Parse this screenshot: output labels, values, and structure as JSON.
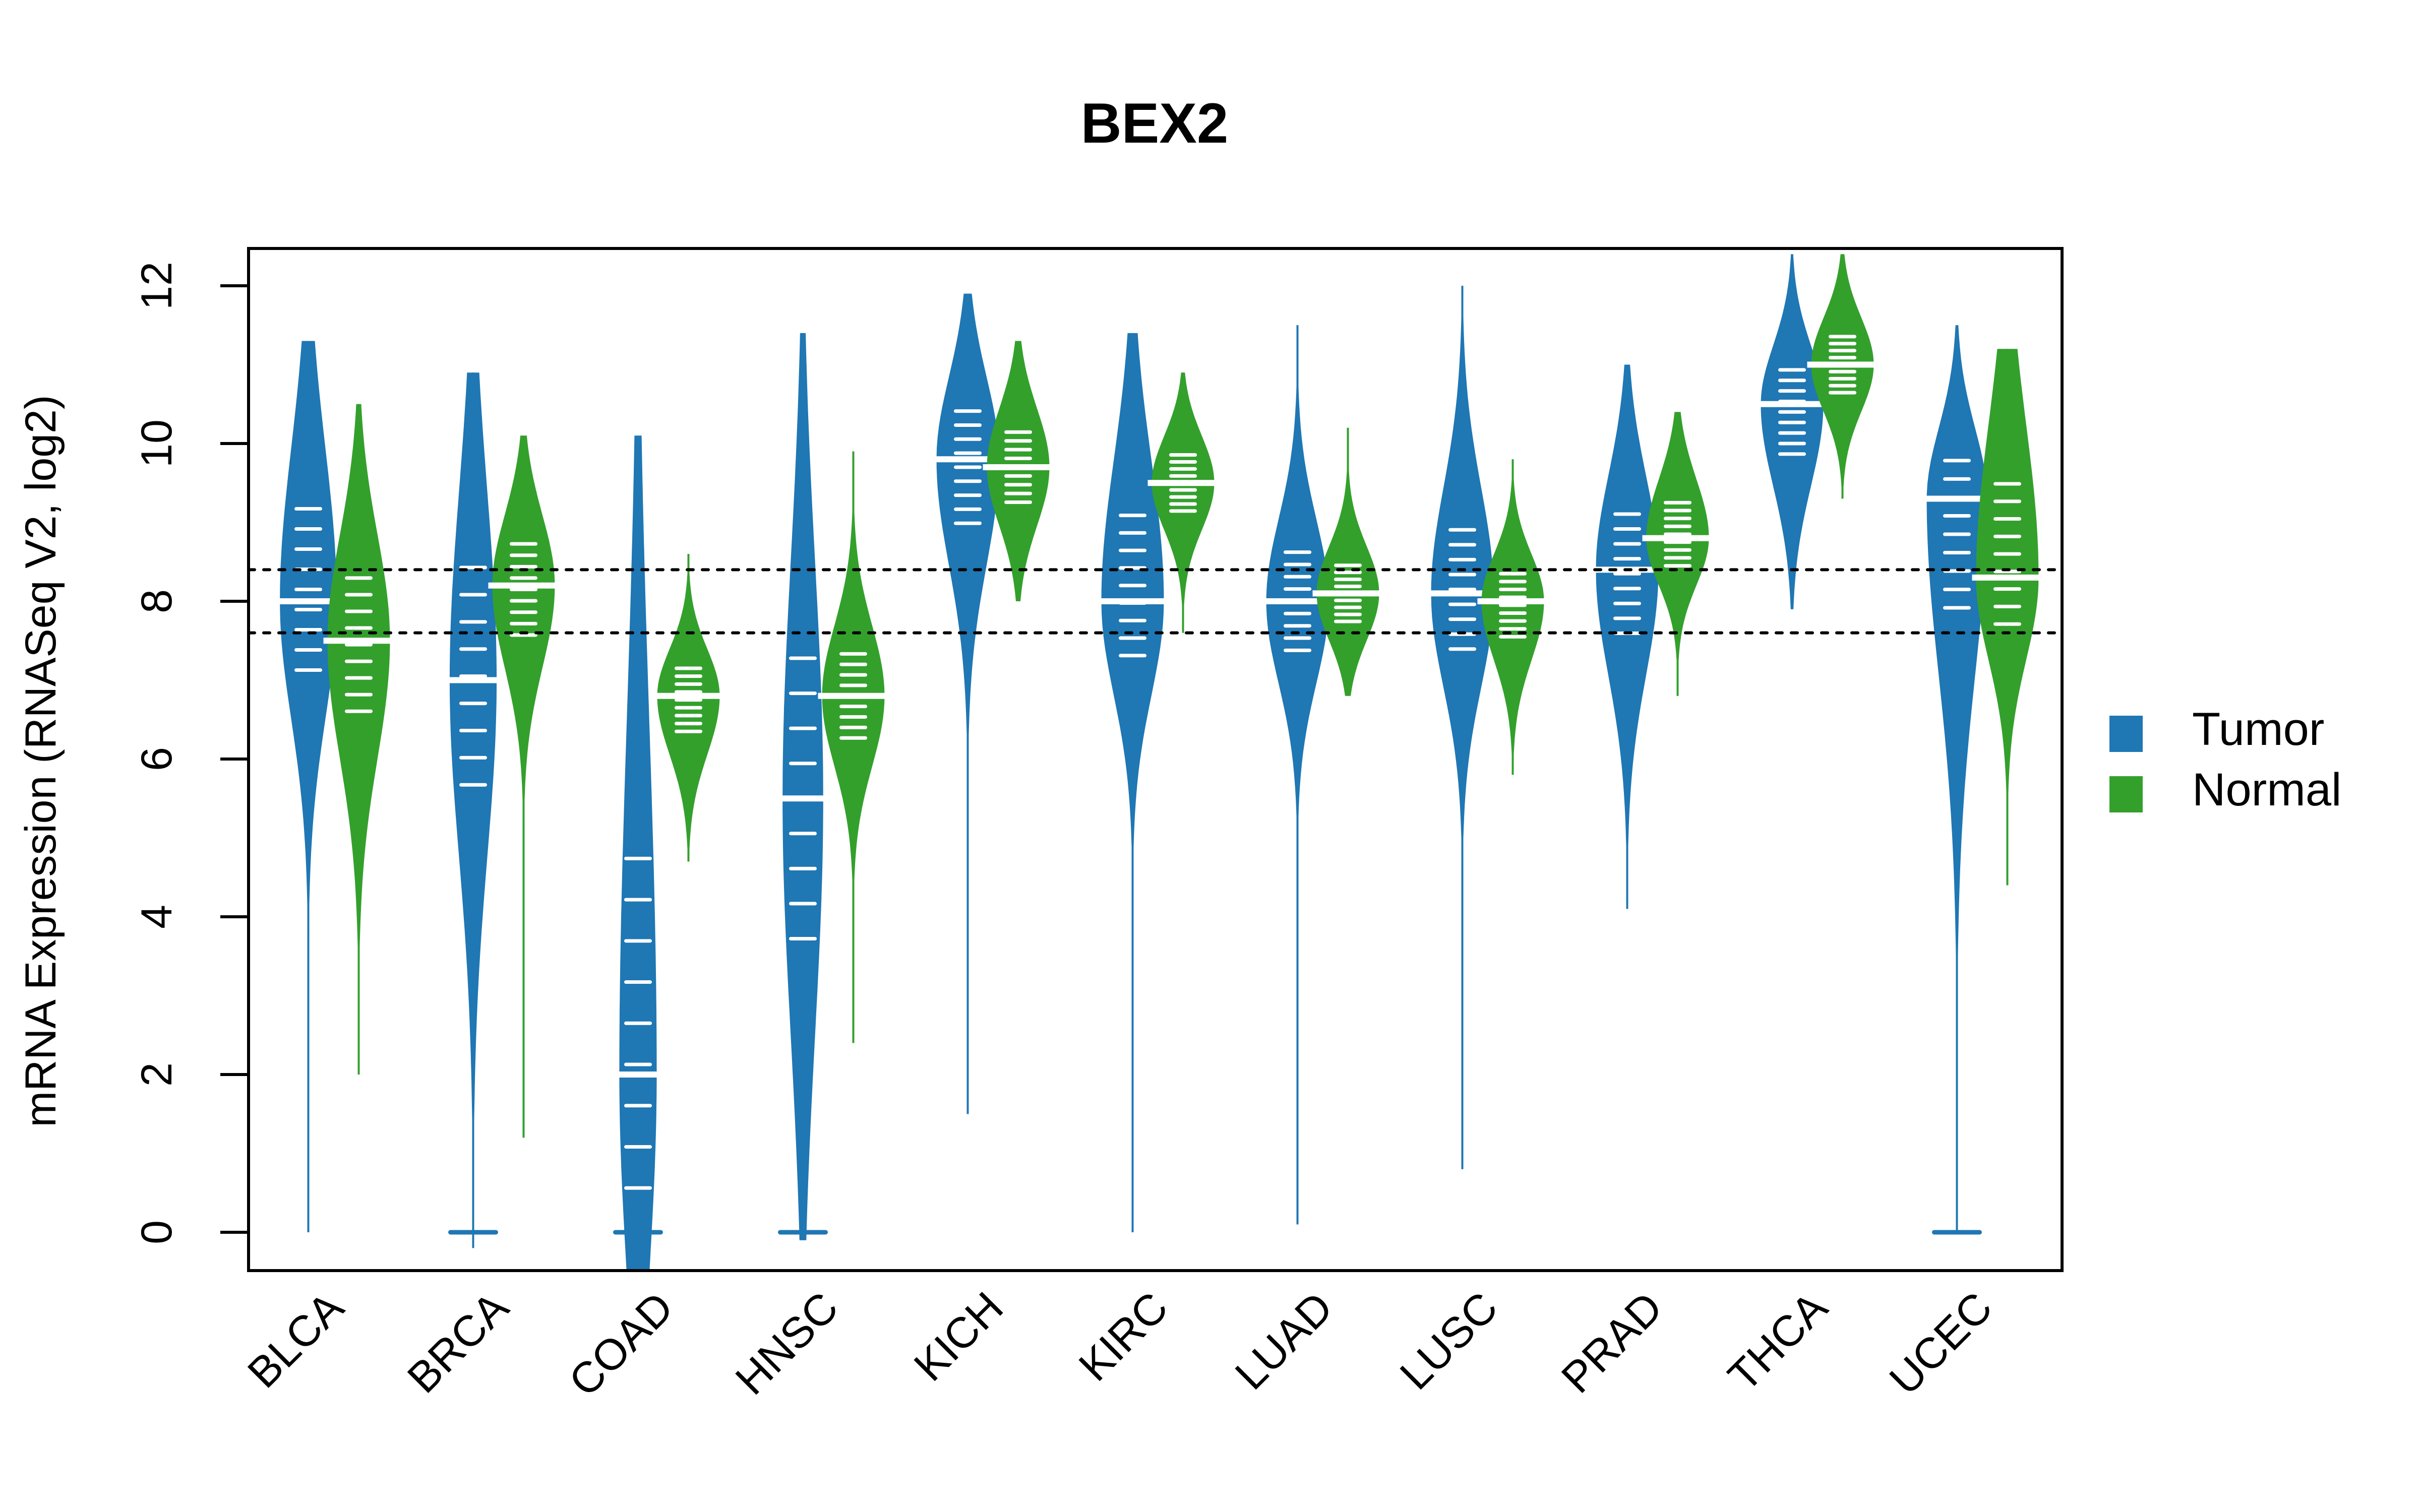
{
  "chart_data": {
    "type": "violin",
    "title": "BEX2",
    "xlabel": "",
    "ylabel": "mRNA Expression (RNASeq V2, log2)",
    "ylim": [
      -0.5,
      12.5
    ],
    "yticks": [
      0,
      2,
      4,
      6,
      8,
      10,
      12
    ],
    "ytick_labels": [
      "0",
      "2",
      "4",
      "6",
      "8",
      "10",
      "12"
    ],
    "grid": false,
    "reference_lines": [
      8.4,
      7.6
    ],
    "categories": [
      "BLCA",
      "BRCA",
      "COAD",
      "HNSC",
      "KICH",
      "KIRC",
      "LUAD",
      "LUSC",
      "PRAD",
      "THCA",
      "UCEC"
    ],
    "legend": {
      "placement": "right",
      "entries": [
        {
          "label": "Tumor",
          "color": "#1F77B4"
        },
        {
          "label": "Normal",
          "color": "#33A02C"
        }
      ]
    },
    "series": [
      {
        "name": "Tumor",
        "color": "#1F77B4",
        "groups": [
          {
            "category": "BLCA",
            "median": 8.0,
            "min": 0.0,
            "max": 11.3,
            "q1": 7.0,
            "q3": 9.3
          },
          {
            "category": "BRCA",
            "median": 7.0,
            "min": -0.2,
            "max": 10.9,
            "q1": 5.5,
            "q3": 8.6
          },
          {
            "category": "COAD",
            "median": 2.0,
            "min": -0.5,
            "max": 10.1,
            "q1": 0.3,
            "q3": 5.0
          },
          {
            "category": "HNSC",
            "median": 5.5,
            "min": -0.1,
            "max": 11.4,
            "q1": 3.5,
            "q3": 7.5
          },
          {
            "category": "KICH",
            "median": 9.8,
            "min": 1.5,
            "max": 11.9,
            "q1": 8.9,
            "q3": 10.5
          },
          {
            "category": "KIRC",
            "median": 8.0,
            "min": 0.0,
            "max": 11.4,
            "q1": 7.2,
            "q3": 9.2
          },
          {
            "category": "LUAD",
            "median": 8.0,
            "min": 0.1,
            "max": 11.5,
            "q1": 7.3,
            "q3": 8.7
          },
          {
            "category": "LUSC",
            "median": 8.1,
            "min": 0.8,
            "max": 12.0,
            "q1": 7.3,
            "q3": 9.0
          },
          {
            "category": "PRAD",
            "median": 8.4,
            "min": 4.1,
            "max": 11.0,
            "q1": 7.5,
            "q3": 9.2
          },
          {
            "category": "THCA",
            "median": 10.5,
            "min": 7.9,
            "max": 12.4,
            "q1": 9.8,
            "q3": 11.0
          },
          {
            "category": "UCEC",
            "median": 9.3,
            "min": 0.0,
            "max": 11.5,
            "q1": 7.8,
            "q3": 9.9
          }
        ]
      },
      {
        "name": "Normal",
        "color": "#33A02C",
        "groups": [
          {
            "category": "BLCA",
            "median": 7.5,
            "min": 2.0,
            "max": 10.5,
            "q1": 6.5,
            "q3": 8.4
          },
          {
            "category": "BRCA",
            "median": 8.2,
            "min": 1.2,
            "max": 10.1,
            "q1": 7.5,
            "q3": 8.8
          },
          {
            "category": "COAD",
            "median": 6.8,
            "min": 4.7,
            "max": 8.6,
            "q1": 6.3,
            "q3": 7.2
          },
          {
            "category": "HNSC",
            "median": 6.8,
            "min": 2.4,
            "max": 9.9,
            "q1": 6.2,
            "q3": 7.4
          },
          {
            "category": "KICH",
            "median": 9.7,
            "min": 8.0,
            "max": 11.3,
            "q1": 9.2,
            "q3": 10.2
          },
          {
            "category": "KIRC",
            "median": 9.5,
            "min": 7.6,
            "max": 10.9,
            "q1": 9.1,
            "q3": 9.9
          },
          {
            "category": "LUAD",
            "median": 8.1,
            "min": 6.8,
            "max": 10.2,
            "q1": 7.7,
            "q3": 8.5
          },
          {
            "category": "LUSC",
            "median": 8.0,
            "min": 5.8,
            "max": 9.8,
            "q1": 7.5,
            "q3": 8.4
          },
          {
            "category": "PRAD",
            "median": 8.8,
            "min": 6.8,
            "max": 10.4,
            "q1": 8.4,
            "q3": 9.3
          },
          {
            "category": "THCA",
            "median": 11.0,
            "min": 9.3,
            "max": 12.4,
            "q1": 10.6,
            "q3": 11.4
          },
          {
            "category": "UCEC",
            "median": 8.3,
            "min": 4.4,
            "max": 11.2,
            "q1": 7.6,
            "q3": 9.6
          }
        ]
      }
    ]
  }
}
